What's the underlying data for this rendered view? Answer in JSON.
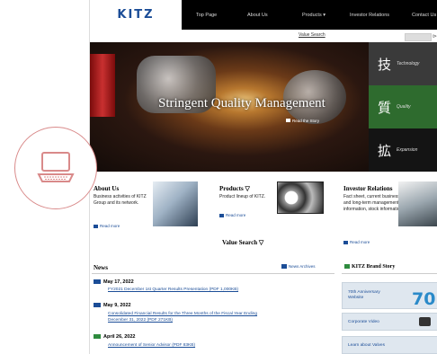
{
  "header": {
    "logo": "KITZ",
    "nav": [
      "Top Page",
      "About Us",
      "Products ▾",
      "Investor Relations",
      "Contact Us"
    ]
  },
  "search": {
    "link": "Value Search",
    "button_icon": "search-icon"
  },
  "hero": {
    "title": "Stringent Quality Management",
    "read_story": "Read the Story",
    "pillars": [
      {
        "kanji": "技",
        "label": "Technology"
      },
      {
        "kanji": "質",
        "label": "Quality"
      },
      {
        "kanji": "拡",
        "label": "Expansion"
      }
    ]
  },
  "sections": {
    "about": {
      "title": "About Us",
      "text": "Business activities of KITZ Group and its network.",
      "readmore": "Read more"
    },
    "products": {
      "title": "Products ▽",
      "text": "Product lineup of KITZ.",
      "readmore": "Read more"
    },
    "investor": {
      "title": "Investor Relations",
      "text": "Fact sheet, current business plan, medium- and long-term management plan, financial information, stock information.",
      "readmore": "Read more"
    },
    "value_search": "Value Search ▽"
  },
  "news": {
    "title": "News",
    "archive": "News Archives",
    "items": [
      {
        "date": "May 17, 2022",
        "text": "FY2021 December 1st Quarter Results Presentation (PDF 1,000KB)"
      },
      {
        "date": "May 9, 2022",
        "text": "Consolidated Financial Results for the Three Months of the Fiscal Year Ending",
        "text2": "December 31, 2022 (PDF 271KB)"
      },
      {
        "date": "April 26, 2022",
        "text": "Announcement of Senior Advisor (PDF 83KB)"
      }
    ]
  },
  "brand": {
    "title": "KITZ Brand Story",
    "items": [
      "70th Anniversary Website",
      "Corporate Video",
      "Learn about Valves"
    ],
    "anniversary_number": "70"
  },
  "colors": {
    "brand_blue": "#1b4d97",
    "accent_red": "#d98a8a",
    "green": "#2e8b3e"
  }
}
